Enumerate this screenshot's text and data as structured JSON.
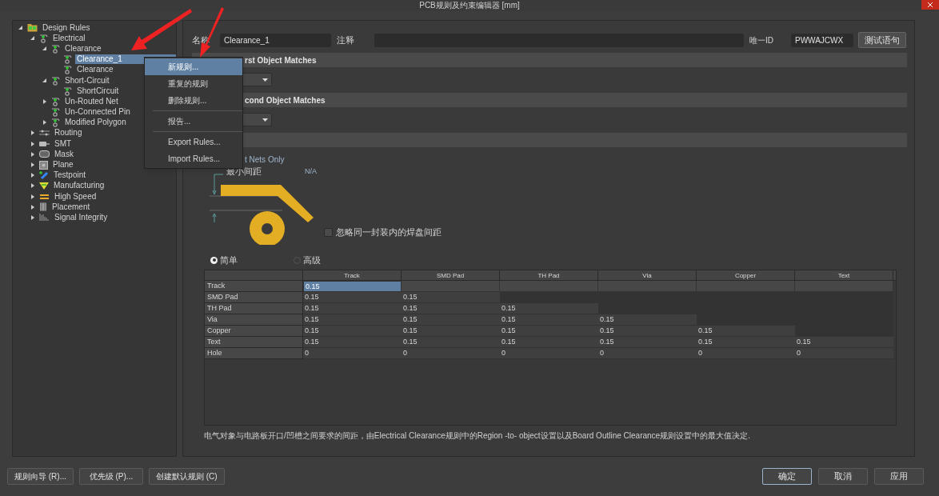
{
  "window": {
    "title": "PCB规则及约束编辑器 [mm]"
  },
  "tree": [
    {
      "label": "Design Rules",
      "expanded": true,
      "selected": false,
      "children": [
        {
          "label": "Electrical",
          "expanded": true,
          "selected": false,
          "children": [
            {
              "label": "Clearance",
              "expanded": true,
              "selected": false,
              "children": [
                {
                  "label": "Clearance_1",
                  "selected": true
                },
                {
                  "label": "Clearance",
                  "selected": false
                }
              ]
            },
            {
              "label": "Short-Circuit",
              "expanded": true,
              "selected": false,
              "children": [
                {
                  "label": "ShortCircuit",
                  "selected": false
                }
              ]
            },
            {
              "label": "Un-Routed Net",
              "expanded": false,
              "selected": false
            },
            {
              "label": "Un-Connected Pin",
              "selected": false
            },
            {
              "label": "Modified Polygon",
              "expanded": false,
              "selected": false
            }
          ]
        },
        {
          "label": "Routing",
          "expanded": false,
          "selected": false
        },
        {
          "label": "SMT",
          "expanded": false,
          "selected": false
        },
        {
          "label": "Mask",
          "expanded": false,
          "selected": false
        },
        {
          "label": "Plane",
          "expanded": false,
          "selected": false
        },
        {
          "label": "Testpoint",
          "expanded": false,
          "selected": false
        },
        {
          "label": "Manufacturing",
          "expanded": false,
          "selected": false
        },
        {
          "label": "High Speed",
          "expanded": false,
          "selected": false
        },
        {
          "label": "Placement",
          "expanded": false,
          "selected": false
        },
        {
          "label": "Signal Integrity",
          "expanded": false,
          "selected": false
        }
      ]
    }
  ],
  "context_menu": [
    {
      "label": "新规则...",
      "selected": true,
      "separator_before": false
    },
    {
      "label": "重复的规则",
      "selected": false,
      "separator_before": false
    },
    {
      "label": "删除规则...",
      "selected": false,
      "separator_before": false
    },
    {
      "label": "报告...",
      "selected": false,
      "separator_before": true
    },
    {
      "label": "Export Rules...",
      "selected": false,
      "separator_before": true
    },
    {
      "label": "Import Rules...",
      "selected": false,
      "separator_before": false
    }
  ],
  "rule": {
    "name_label": "名称",
    "name": "Clearance_1",
    "comment_label": "注释",
    "id_label": "唯一ID",
    "id": "PWWAJCWX",
    "test_button": "测试语句"
  },
  "sections": [
    {
      "header": "rst Object Matches",
      "has_dropdown": true
    },
    {
      "header": "cond Object Matches",
      "has_dropdown": true
    },
    {
      "has_dropdown": false
    }
  ],
  "connective": "t Nets Only",
  "diagram": {
    "label": "最小间距",
    "value": "N/A",
    "checkbox": {
      "label": "忽略同一封装内的焊盘间距",
      "checked": false
    }
  },
  "modes": [
    {
      "label": "简单",
      "selected": true
    },
    {
      "label": "高级",
      "selected": false
    }
  ],
  "table": {
    "columns": [
      "Track",
      "SMD Pad",
      "TH Pad",
      "Via",
      "Copper",
      "Text"
    ],
    "rows": [
      {
        "label": "Track",
        "cells": [
          {
            "text": "0.15",
            "selected": true
          }
        ]
      },
      {
        "label": "SMD Pad",
        "cells": [
          {
            "text": "0.15",
            "selected": false
          },
          {
            "text": "0.15",
            "selected": false
          }
        ]
      },
      {
        "label": "TH Pad",
        "cells": [
          {
            "text": "0.15",
            "selected": false
          },
          {
            "text": "0.15",
            "selected": false
          },
          {
            "text": "0.15",
            "selected": false
          }
        ]
      },
      {
        "label": "Via",
        "cells": [
          {
            "text": "0.15",
            "selected": false
          },
          {
            "text": "0.15",
            "selected": false
          },
          {
            "text": "0.15",
            "selected": false
          },
          {
            "text": "0.15",
            "selected": false
          }
        ]
      },
      {
        "label": "Copper",
        "cells": [
          {
            "text": "0.15",
            "selected": false
          },
          {
            "text": "0.15",
            "selected": false
          },
          {
            "text": "0.15",
            "selected": false
          },
          {
            "text": "0.15",
            "selected": false
          },
          {
            "text": "0.15",
            "selected": false
          }
        ]
      },
      {
        "label": "Text",
        "cells": [
          {
            "text": "0.15",
            "selected": false
          },
          {
            "text": "0.15",
            "selected": false
          },
          {
            "text": "0.15",
            "selected": false
          },
          {
            "text": "0.15",
            "selected": false
          },
          {
            "text": "0.15",
            "selected": false
          },
          {
            "text": "0.15",
            "selected": false
          }
        ]
      },
      {
        "label": "Hole",
        "cells": [
          {
            "text": "0",
            "selected": false
          },
          {
            "text": "0",
            "selected": false
          },
          {
            "text": "0",
            "selected": false
          },
          {
            "text": "0",
            "selected": false
          },
          {
            "text": "0",
            "selected": false
          },
          {
            "text": "0",
            "selected": false
          }
        ]
      }
    ]
  },
  "description": "电气对象与电路板开口/凹槽之间要求的间距，由Electrical Clearance规则中的Region -to- object设置以及Board Outline Clearance规则设置中的最大值决定.",
  "left_buttons": [
    {
      "label": "规则向导 (R)..."
    },
    {
      "label": "优先级 (P)..."
    },
    {
      "label": "创建默认规则 (C)"
    }
  ],
  "right_buttons": [
    {
      "label": "确定",
      "focused": true
    },
    {
      "label": "取消",
      "focused": false
    },
    {
      "label": "应用",
      "focused": false
    }
  ]
}
